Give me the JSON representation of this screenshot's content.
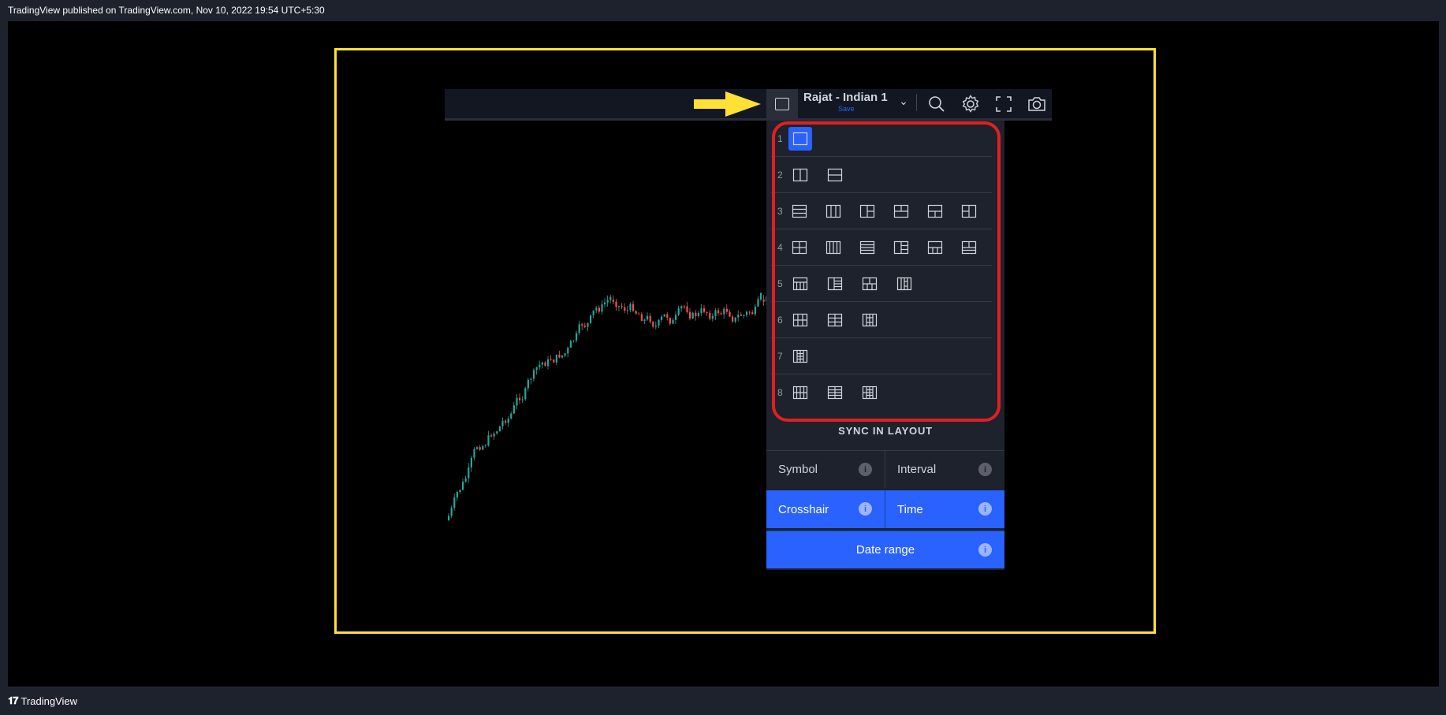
{
  "header": {
    "published": "TradingView published on TradingView.com, Nov 10, 2022 19:54 UTC+5:30"
  },
  "footer": {
    "brand": "TradingView"
  },
  "toolbar": {
    "layout_name": "Rajat - Indian 1",
    "save_label": "Save",
    "icons": [
      "layout-icon",
      "chevron-down-icon",
      "search-icon",
      "gear-icon",
      "fullscreen-icon",
      "camera-icon"
    ]
  },
  "layouts": [
    {
      "label": "1",
      "icons": [
        "single"
      ]
    },
    {
      "label": "2",
      "icons": [
        "2v",
        "2h"
      ]
    },
    {
      "label": "3",
      "icons": [
        "3h",
        "3v",
        "3a",
        "3b",
        "3c",
        "3d"
      ]
    },
    {
      "label": "4",
      "icons": [
        "4g",
        "4v",
        "4h",
        "4a",
        "4b",
        "4c"
      ]
    },
    {
      "label": "5",
      "icons": [
        "5a",
        "5b",
        "5c",
        "5d"
      ]
    },
    {
      "label": "6",
      "icons": [
        "6a",
        "6b",
        "6c"
      ]
    },
    {
      "label": "7",
      "icons": [
        "7a"
      ]
    },
    {
      "label": "8",
      "icons": [
        "8a",
        "8b",
        "8c"
      ]
    }
  ],
  "selected_layout": "single",
  "sync": {
    "title": "SYNC IN LAYOUT",
    "symbol": "Symbol",
    "interval": "Interval",
    "crosshair": "Crosshair",
    "time": "Time",
    "date_range": "Date range",
    "info_glyph": "i"
  },
  "colors": {
    "accent": "#2962ff",
    "highlight_frame": "#ffe135",
    "annotation_red": "#e02020",
    "candle_up": "#26a69a",
    "candle_down": "#ef5350"
  }
}
